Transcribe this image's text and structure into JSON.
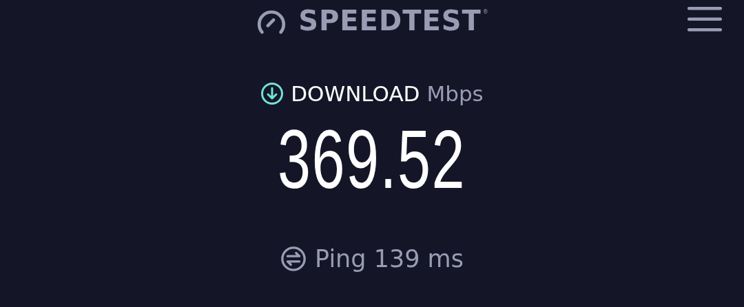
{
  "header": {
    "logo_text": "SPEEDTEST",
    "logo_mark": "®"
  },
  "result": {
    "label": "DOWNLOAD",
    "unit": "Mbps",
    "value": "369.52"
  },
  "ping": {
    "label": "Ping 139 ms"
  }
}
